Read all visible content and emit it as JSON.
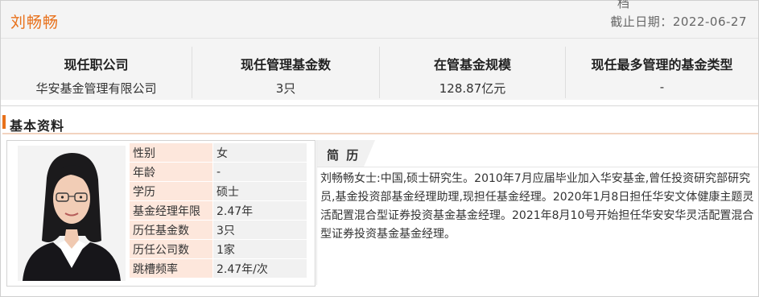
{
  "manager": {
    "name": "刘畅畅"
  },
  "header": {
    "top_mark": "档",
    "deadline_label": "截止日期：",
    "deadline_value": "2022-06-27"
  },
  "summary": [
    {
      "label": "现任职公司",
      "value": "华安基金管理有限公司"
    },
    {
      "label": "现任管理基金数",
      "value": "3只"
    },
    {
      "label": "在管基金规模",
      "value": "128.87亿元"
    },
    {
      "label": "现任最多管理的基金类型",
      "value": "-"
    }
  ],
  "section": {
    "title": "基本资料"
  },
  "profile": [
    {
      "key": "性别",
      "value": "女"
    },
    {
      "key": "年龄",
      "value": "-"
    },
    {
      "key": "学历",
      "value": "硕士"
    },
    {
      "key": "基金经理年限",
      "value": "2.47年"
    },
    {
      "key": "历任基金数",
      "value": "3只"
    },
    {
      "key": "历任公司数",
      "value": "1家"
    },
    {
      "key": "跳槽频率",
      "value": "2.47年/次"
    }
  ],
  "resume": {
    "title": "简 历",
    "text": "刘畅畅女士:中国,硕士研究生。2010年7月应届毕业加入华安基金,曾任投资研究部研究员,基金投资部基金经理助理,现担任基金经理。2020年1月8日担任华安文体健康主题灵活配置混合型证券投资基金基金经理。2021年8月10号开始担任华安安华灵活配置混合型证券投资基金基金经理。"
  },
  "colors": {
    "accent": "#e8711b",
    "key_bg": "#fde7dc",
    "value_bg": "#f1f1f1",
    "panel_bg": "#f4f4f4"
  }
}
